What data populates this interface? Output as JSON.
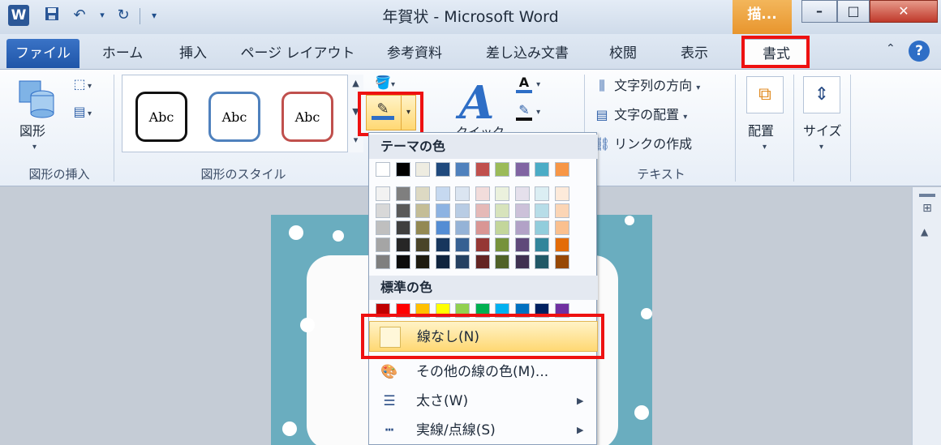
{
  "window": {
    "title": "年賀状 - Microsoft Word",
    "context_tab": "描...",
    "app_icon": "W"
  },
  "quick_access": {
    "icons": [
      "save-icon",
      "undo-icon",
      "redo-icon",
      "customize-icon"
    ]
  },
  "window_controls": {
    "minimize": "–",
    "maximize": "□",
    "close": "✕"
  },
  "tabs": {
    "file": "ファイル",
    "home": "ホーム",
    "insert": "挿入",
    "page_layout": "ページ レイアウト",
    "references": "参考資料",
    "mailings": "差し込み文書",
    "review": "校閲",
    "view": "表示",
    "format": "書式"
  },
  "ribbon": {
    "insert_shapes": {
      "label": "図形の挿入",
      "shape_button": "図形"
    },
    "shape_styles": {
      "label": "図形のスタイル",
      "styles": [
        "Abc",
        "Abc",
        "Abc"
      ]
    },
    "wordart": {
      "quick_styles_partial": "クイック"
    },
    "text": {
      "label": "テキスト",
      "direction": "文字列の方向",
      "align": "文字の配置",
      "link": "リンクの作成"
    },
    "arrange": {
      "label": "配置"
    },
    "size": {
      "label": "サイズ"
    }
  },
  "menu": {
    "theme_colors_header": "テーマの色",
    "standard_colors_header": "標準の色",
    "theme_top_row": [
      "#ffffff",
      "#000000",
      "#eeece1",
      "#1f497d",
      "#4f81bd",
      "#c0504d",
      "#9bbb59",
      "#8064a2",
      "#4bacc6",
      "#f79646"
    ],
    "theme_shades": [
      [
        "#f2f2f2",
        "#7f7f7f",
        "#ddd9c3",
        "#c6d9f0",
        "#dbe5f1",
        "#f2dcdb",
        "#ebf1dd",
        "#e5e0ec",
        "#dbeef3",
        "#fdeada"
      ],
      [
        "#d8d8d8",
        "#595959",
        "#c4bd97",
        "#8db3e2",
        "#b8cce4",
        "#e5b9b7",
        "#d7e3bc",
        "#ccc1d9",
        "#b7dde8",
        "#fbd5b5"
      ],
      [
        "#bfbfbf",
        "#3f3f3f",
        "#938953",
        "#548dd4",
        "#95b3d7",
        "#d99694",
        "#c3d69b",
        "#b2a2c7",
        "#92cddc",
        "#fac08f"
      ],
      [
        "#a5a5a5",
        "#262626",
        "#494429",
        "#17365d",
        "#366092",
        "#953734",
        "#76923c",
        "#5f497a",
        "#31859b",
        "#e36c09"
      ],
      [
        "#7f7f7f",
        "#0c0c0c",
        "#1d1b10",
        "#0f243e",
        "#244061",
        "#632423",
        "#4f6128",
        "#3f3151",
        "#205867",
        "#974806"
      ]
    ],
    "standard_colors": [
      "#c00000",
      "#ff0000",
      "#ffc000",
      "#ffff00",
      "#92d050",
      "#00b050",
      "#00b0f0",
      "#0070c0",
      "#002060",
      "#7030a0"
    ],
    "no_line": "線なし(N)",
    "more_colors": "その他の線の色(M)...",
    "weight": "太さ(W)",
    "dashes": "実線/点線(S)"
  },
  "colors": {
    "highlight": "#ee1111",
    "accent": "#2e6ec6",
    "hover": "#ffd873"
  }
}
